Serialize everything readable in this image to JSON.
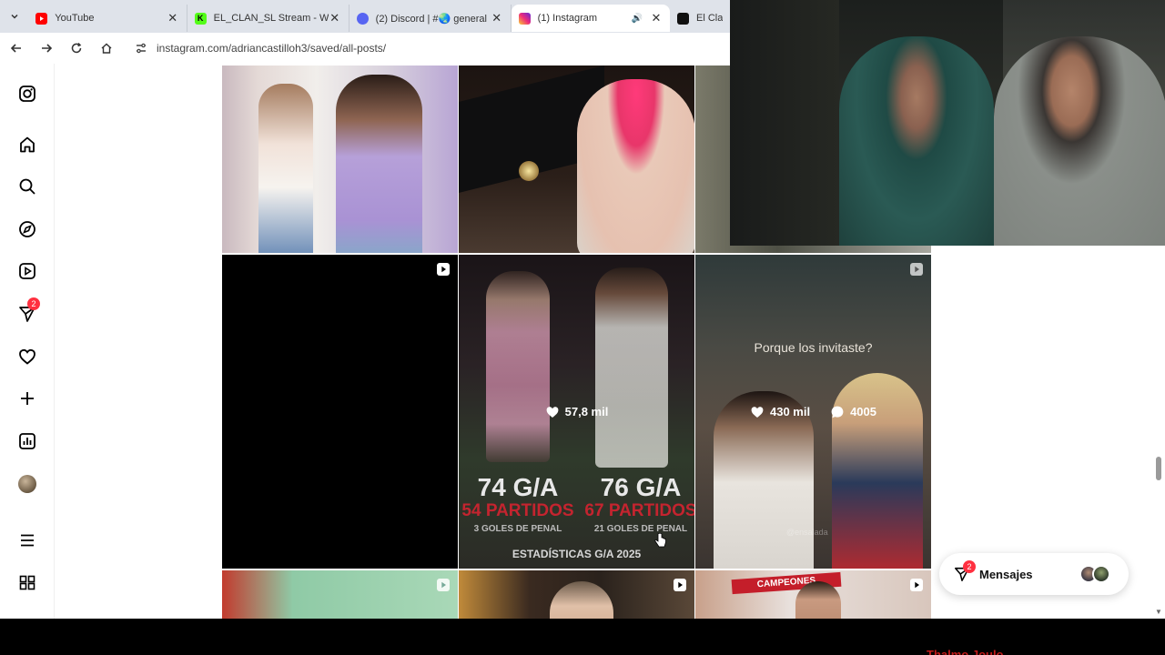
{
  "browser": {
    "tabs": [
      {
        "title": "YouTube",
        "favicon_color": "#ff0000"
      },
      {
        "title": "EL_CLAN_SL Stream - Watc",
        "favicon_color": "#53fc18"
      },
      {
        "title": "(2) Discord | #🌏 general |",
        "favicon_color": "#5865f2"
      },
      {
        "title": "(1) Instagram",
        "favicon_color": "#e1306c",
        "active": true
      },
      {
        "title": "El Clan",
        "favicon_color": "#111111"
      }
    ],
    "url": "instagram.com/adriancastilloh3/saved/all-posts/"
  },
  "sidebar": {
    "items": [
      {
        "name": "instagram-logo-icon"
      },
      {
        "name": "home-icon"
      },
      {
        "name": "search-icon"
      },
      {
        "name": "explore-icon"
      },
      {
        "name": "reels-icon"
      },
      {
        "name": "messages-icon",
        "badge": "2"
      },
      {
        "name": "notifications-icon"
      },
      {
        "name": "create-icon"
      },
      {
        "name": "dashboard-icon"
      },
      {
        "name": "profile-avatar"
      },
      {
        "name": "more-menu-icon"
      },
      {
        "name": "also-from-meta-icon"
      }
    ]
  },
  "grid": {
    "posts": [
      {
        "reel": false
      },
      {
        "reel": false
      },
      {
        "reel": false
      },
      {
        "reel": true
      },
      {
        "reel": false,
        "likes": "57,8 mil",
        "left_stat": "74 G/A",
        "left_games": "54 PARTIDOS",
        "left_pen": "3 GOLES DE PENAL",
        "right_stat": "76 G/A",
        "right_games": "67 PARTIDOS",
        "right_pen": "21 GOLES DE PENAL",
        "caption": "ESTADÍSTICAS G/A 2025"
      },
      {
        "reel": true,
        "likes": "430 mil",
        "comments": "4005",
        "caption": "Porque los invitaste?",
        "watermark": "@ensalada"
      },
      {
        "reel": true
      },
      {
        "reel": true
      },
      {
        "reel": true,
        "banner": "CAMPEONES"
      }
    ]
  },
  "messages": {
    "label": "Mensajes",
    "badge": "2"
  },
  "overlay": {
    "strip_text": "Thalmo Joulo"
  }
}
